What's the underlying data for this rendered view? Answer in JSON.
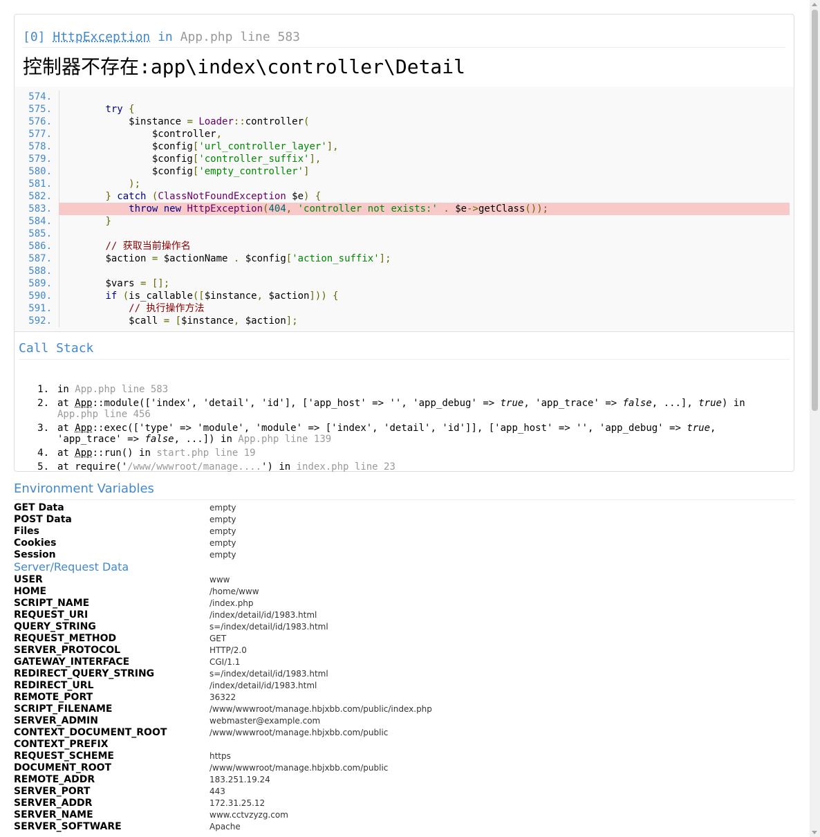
{
  "exception": {
    "index": "[0]",
    "class": "HttpException",
    "in_word": "in",
    "file": "App.php",
    "line_label": "line 583",
    "message": "控制器不存在:app\\index\\controller\\Detail"
  },
  "source_lines": [
    {
      "num": "574.",
      "highlight": false,
      "parts": []
    },
    {
      "num": "575.",
      "highlight": false,
      "parts": [
        [
          "",
          "        "
        ],
        [
          "k",
          "try"
        ],
        [
          "p",
          " {"
        ]
      ]
    },
    {
      "num": "576.",
      "highlight": false,
      "parts": [
        [
          "",
          "            "
        ],
        [
          "v",
          "$instance"
        ],
        [
          "p",
          " = "
        ],
        [
          "t",
          "Loader"
        ],
        [
          "p",
          "::"
        ],
        [
          "v",
          "controller"
        ],
        [
          "p",
          "("
        ]
      ]
    },
    {
      "num": "577.",
      "highlight": false,
      "parts": [
        [
          "",
          "                "
        ],
        [
          "v",
          "$controller"
        ],
        [
          "p",
          ","
        ]
      ]
    },
    {
      "num": "578.",
      "highlight": false,
      "parts": [
        [
          "",
          "                "
        ],
        [
          "v",
          "$config"
        ],
        [
          "p",
          "["
        ],
        [
          "s",
          "'url_controller_layer'"
        ],
        [
          "p",
          "],"
        ]
      ]
    },
    {
      "num": "579.",
      "highlight": false,
      "parts": [
        [
          "",
          "                "
        ],
        [
          "v",
          "$config"
        ],
        [
          "p",
          "["
        ],
        [
          "s",
          "'controller_suffix'"
        ],
        [
          "p",
          "],"
        ]
      ]
    },
    {
      "num": "580.",
      "highlight": false,
      "parts": [
        [
          "",
          "                "
        ],
        [
          "v",
          "$config"
        ],
        [
          "p",
          "["
        ],
        [
          "s",
          "'empty_controller'"
        ],
        [
          "p",
          "]"
        ]
      ]
    },
    {
      "num": "581.",
      "highlight": false,
      "parts": [
        [
          "",
          "            "
        ],
        [
          "p",
          ");"
        ]
      ]
    },
    {
      "num": "582.",
      "highlight": false,
      "parts": [
        [
          "",
          "        "
        ],
        [
          "p",
          "} "
        ],
        [
          "k",
          "catch"
        ],
        [
          "p",
          " ("
        ],
        [
          "t",
          "ClassNotFoundException"
        ],
        [
          "v",
          " $e"
        ],
        [
          "p",
          ") {"
        ]
      ]
    },
    {
      "num": "583.",
      "highlight": true,
      "parts": [
        [
          "",
          "            "
        ],
        [
          "k",
          "throw new"
        ],
        [
          "v",
          " "
        ],
        [
          "t",
          "HttpException"
        ],
        [
          "p",
          "("
        ],
        [
          "n",
          "404"
        ],
        [
          "p",
          ", "
        ],
        [
          "s",
          "'controller not exists:'"
        ],
        [
          "p",
          " . "
        ],
        [
          "v",
          "$e"
        ],
        [
          "p",
          "->"
        ],
        [
          "v",
          "getClass"
        ],
        [
          "p",
          "());"
        ]
      ]
    },
    {
      "num": "584.",
      "highlight": false,
      "parts": [
        [
          "",
          "        "
        ],
        [
          "p",
          "}"
        ]
      ]
    },
    {
      "num": "585.",
      "highlight": false,
      "parts": []
    },
    {
      "num": "586.",
      "highlight": false,
      "parts": [
        [
          "",
          "        "
        ],
        [
          "c",
          "// 获取当前操作名"
        ]
      ]
    },
    {
      "num": "587.",
      "highlight": false,
      "parts": [
        [
          "",
          "        "
        ],
        [
          "v",
          "$action"
        ],
        [
          "p",
          " = "
        ],
        [
          "v",
          "$actionName"
        ],
        [
          "p",
          " . "
        ],
        [
          "v",
          "$config"
        ],
        [
          "p",
          "["
        ],
        [
          "s",
          "'action_suffix'"
        ],
        [
          "p",
          "];"
        ]
      ]
    },
    {
      "num": "588.",
      "highlight": false,
      "parts": []
    },
    {
      "num": "589.",
      "highlight": false,
      "parts": [
        [
          "",
          "        "
        ],
        [
          "v",
          "$vars"
        ],
        [
          "p",
          " = [];"
        ]
      ]
    },
    {
      "num": "590.",
      "highlight": false,
      "parts": [
        [
          "",
          "        "
        ],
        [
          "k",
          "if"
        ],
        [
          "p",
          " ("
        ],
        [
          "v",
          "is_callable"
        ],
        [
          "p",
          "(["
        ],
        [
          "v",
          "$instance"
        ],
        [
          "p",
          ", "
        ],
        [
          "v",
          "$action"
        ],
        [
          "p",
          "])) {"
        ]
      ]
    },
    {
      "num": "591.",
      "highlight": false,
      "parts": [
        [
          "",
          "            "
        ],
        [
          "c",
          "// 执行操作方法"
        ]
      ]
    },
    {
      "num": "592.",
      "highlight": false,
      "parts": [
        [
          "",
          "            "
        ],
        [
          "v",
          "$call"
        ],
        [
          "p",
          " = ["
        ],
        [
          "v",
          "$instance"
        ],
        [
          "p",
          ", "
        ],
        [
          "v",
          "$action"
        ],
        [
          "p",
          "];"
        ]
      ]
    }
  ],
  "call_stack": {
    "title": "Call Stack",
    "items": [
      {
        "idx": "1.",
        "html_parts": [
          [
            "",
            "in "
          ],
          [
            "gray",
            "App.php line 583"
          ]
        ]
      },
      {
        "idx": "2.",
        "html_parts": [
          [
            "",
            "at "
          ],
          [
            "abbr",
            "App"
          ],
          [
            "",
            "::module(['index', 'detail', 'id'], ['app_host' => '', 'app_debug' => "
          ],
          [
            "i",
            "true"
          ],
          [
            "",
            ", 'app_trace' => "
          ],
          [
            "i",
            "false"
          ],
          [
            "",
            ", ...], "
          ],
          [
            "i",
            "true"
          ],
          [
            "",
            ") in\n"
          ],
          [
            "gray",
            "App.php line 456"
          ]
        ]
      },
      {
        "idx": "3.",
        "html_parts": [
          [
            "",
            "at "
          ],
          [
            "abbr",
            "App"
          ],
          [
            "",
            "::exec(['type' => 'module', 'module' => ['index', 'detail', 'id']], ['app_host' => '', 'app_debug' => "
          ],
          [
            "i",
            "true"
          ],
          [
            "",
            ",\n'app_trace' => "
          ],
          [
            "i",
            "false"
          ],
          [
            "",
            ", ...]) in "
          ],
          [
            "gray",
            "App.php line 139"
          ]
        ]
      },
      {
        "idx": "4.",
        "html_parts": [
          [
            "",
            "at "
          ],
          [
            "abbr",
            "App"
          ],
          [
            "",
            "::run() in "
          ],
          [
            "gray",
            "start.php line 19"
          ]
        ]
      },
      {
        "idx": "5.",
        "html_parts": [
          [
            "",
            "at require('"
          ],
          [
            "gray",
            "/www/wwwroot/manage...."
          ],
          [
            "",
            "') in "
          ],
          [
            "gray",
            "index.php line 23"
          ]
        ]
      }
    ]
  },
  "env": {
    "title": "Environment Variables",
    "request": [
      {
        "key": "GET Data",
        "value": "empty"
      },
      {
        "key": "POST Data",
        "value": "empty"
      },
      {
        "key": "Files",
        "value": "empty"
      },
      {
        "key": "Cookies",
        "value": "empty"
      },
      {
        "key": "Session",
        "value": "empty"
      }
    ],
    "server_title": "Server/Request Data",
    "server": [
      {
        "key": "USER",
        "value": "www"
      },
      {
        "key": "HOME",
        "value": "/home/www"
      },
      {
        "key": "SCRIPT_NAME",
        "value": "/index.php"
      },
      {
        "key": "REQUEST_URI",
        "value": "/index/detail/id/1983.html"
      },
      {
        "key": "QUERY_STRING",
        "value": "s=/index/detail/id/1983.html"
      },
      {
        "key": "REQUEST_METHOD",
        "value": "GET"
      },
      {
        "key": "SERVER_PROTOCOL",
        "value": "HTTP/2.0"
      },
      {
        "key": "GATEWAY_INTERFACE",
        "value": "CGI/1.1"
      },
      {
        "key": "REDIRECT_QUERY_STRING",
        "value": "s=/index/detail/id/1983.html"
      },
      {
        "key": "REDIRECT_URL",
        "value": "/index/detail/id/1983.html"
      },
      {
        "key": "REMOTE_PORT",
        "value": "36322"
      },
      {
        "key": "SCRIPT_FILENAME",
        "value": "/www/wwwroot/manage.hbjxbb.com/public/index.php"
      },
      {
        "key": "SERVER_ADMIN",
        "value": "webmaster@example.com"
      },
      {
        "key": "CONTEXT_DOCUMENT_ROOT",
        "value": "/www/wwwroot/manage.hbjxbb.com/public"
      },
      {
        "key": "CONTEXT_PREFIX",
        "value": ""
      },
      {
        "key": "REQUEST_SCHEME",
        "value": "https"
      },
      {
        "key": "DOCUMENT_ROOT",
        "value": "/www/wwwroot/manage.hbjxbb.com/public"
      },
      {
        "key": "REMOTE_ADDR",
        "value": "183.251.19.24"
      },
      {
        "key": "SERVER_PORT",
        "value": "443"
      },
      {
        "key": "SERVER_ADDR",
        "value": "172.31.25.12"
      },
      {
        "key": "SERVER_NAME",
        "value": "www.cctvzyzg.com"
      },
      {
        "key": "SERVER_SOFTWARE",
        "value": "Apache"
      }
    ]
  }
}
